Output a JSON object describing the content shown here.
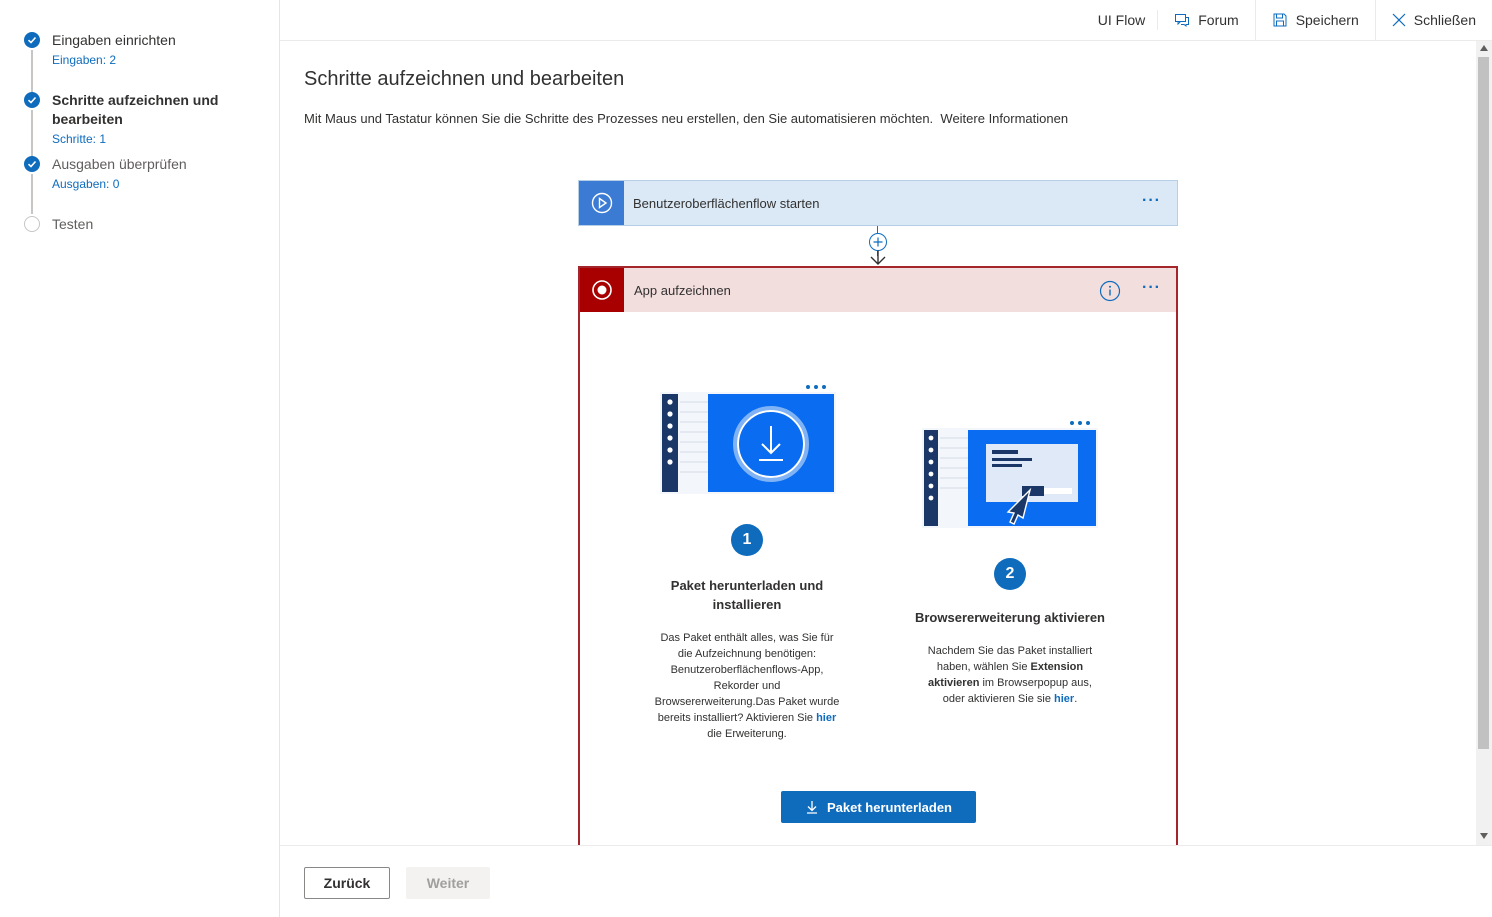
{
  "sidebar": {
    "steps": [
      {
        "title": "Eingaben einrichten",
        "sub": "Eingaben: 2",
        "state": "done"
      },
      {
        "title_line1": "Schritte aufzeichnen und",
        "title_line2": "bearbeiten",
        "sub": "Schritte: 1",
        "state": "done-active"
      },
      {
        "title": "Ausgaben überprüfen",
        "sub": "Ausgaben: 0",
        "state": "done"
      },
      {
        "title": "Testen",
        "state": "pending"
      }
    ]
  },
  "topbar": {
    "title": "UI Flow",
    "forum_label": "Forum",
    "save_label": "Speichern",
    "close_label": "Schließen"
  },
  "main": {
    "title": "Schritte aufzeichnen und bearbeiten",
    "description": "Mit Maus und Tastatur können Sie die Schritte des Prozesses neu erstellen, den Sie automatisieren möchten.",
    "learn_more": "Weitere Informationen",
    "start_card": {
      "label": "Benutzeroberflächenflow starten",
      "more": "···"
    },
    "record_card": {
      "label": "App aufzeichnen",
      "more": "···",
      "info": "i",
      "step1": {
        "number": "1",
        "heading_line1": "Paket herunterladen und",
        "heading_line2": "installieren",
        "text_line1": "Das Paket enthält alles, was Sie für",
        "text_line2": "die Aufzeichnung benötigen:",
        "text_line3": "Benutzeroberflächenflows-App,",
        "text_line4": "Rekorder und",
        "text_line5": "Browsererweiterung.Das Paket wurde",
        "text_line6_pre": "bereits installiert? Aktivieren Sie",
        "text_link": "hier",
        "text_line7": "die Erweiterung."
      },
      "step2": {
        "number": "2",
        "heading": "Browsererweiterung aktivieren",
        "text_line1": "Nachdem Sie das Paket installiert",
        "text_line2_pre": "haben, wählen Sie",
        "text_bold1": "Extension",
        "text_bold2": "aktivieren",
        "text_line3_post": "im Browserpopup aus,",
        "text_line4_pre": "oder aktivieren Sie sie",
        "text_link": "hier",
        "text_line4_post": "."
      },
      "download_button": "Paket herunterladen"
    }
  },
  "footer": {
    "back_label": "Zurück",
    "next_label": "Weiter"
  },
  "colors": {
    "accent": "#0f6cbd",
    "record_red": "#a80000",
    "record_border": "#a4262c",
    "start_bg": "#dbe9f6"
  }
}
